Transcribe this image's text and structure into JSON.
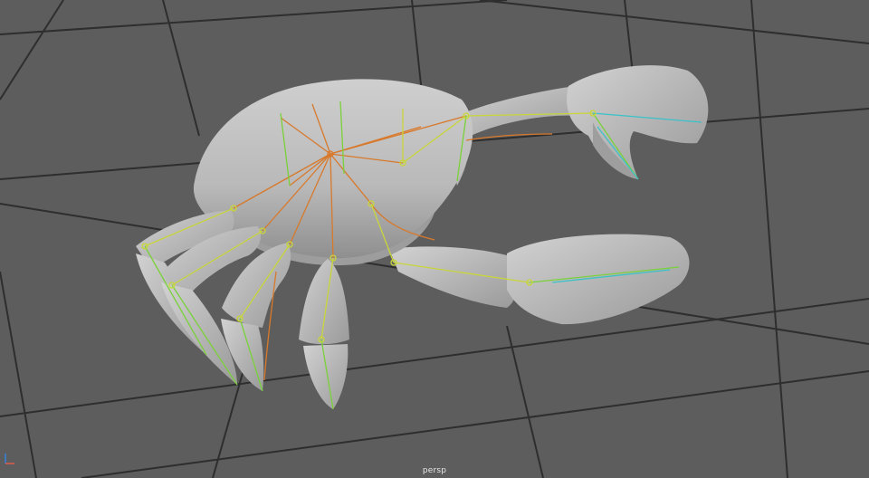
{
  "viewport": {
    "camera_label": "persp",
    "colors": {
      "background": "#5d5d5d",
      "grid": "#2b2b2b",
      "mesh": "#bdbdbd",
      "mesh_shadow": "#8e8e8e",
      "joint_green": "#7ad13a",
      "joint_yellow": "#c8d63a",
      "joint_orange": "#d8792b",
      "joint_cyan": "#3bc2c8"
    },
    "axis_gizmo": {
      "x_axis_icon": "axis-x-icon",
      "y_axis_icon": "axis-y-icon"
    }
  }
}
